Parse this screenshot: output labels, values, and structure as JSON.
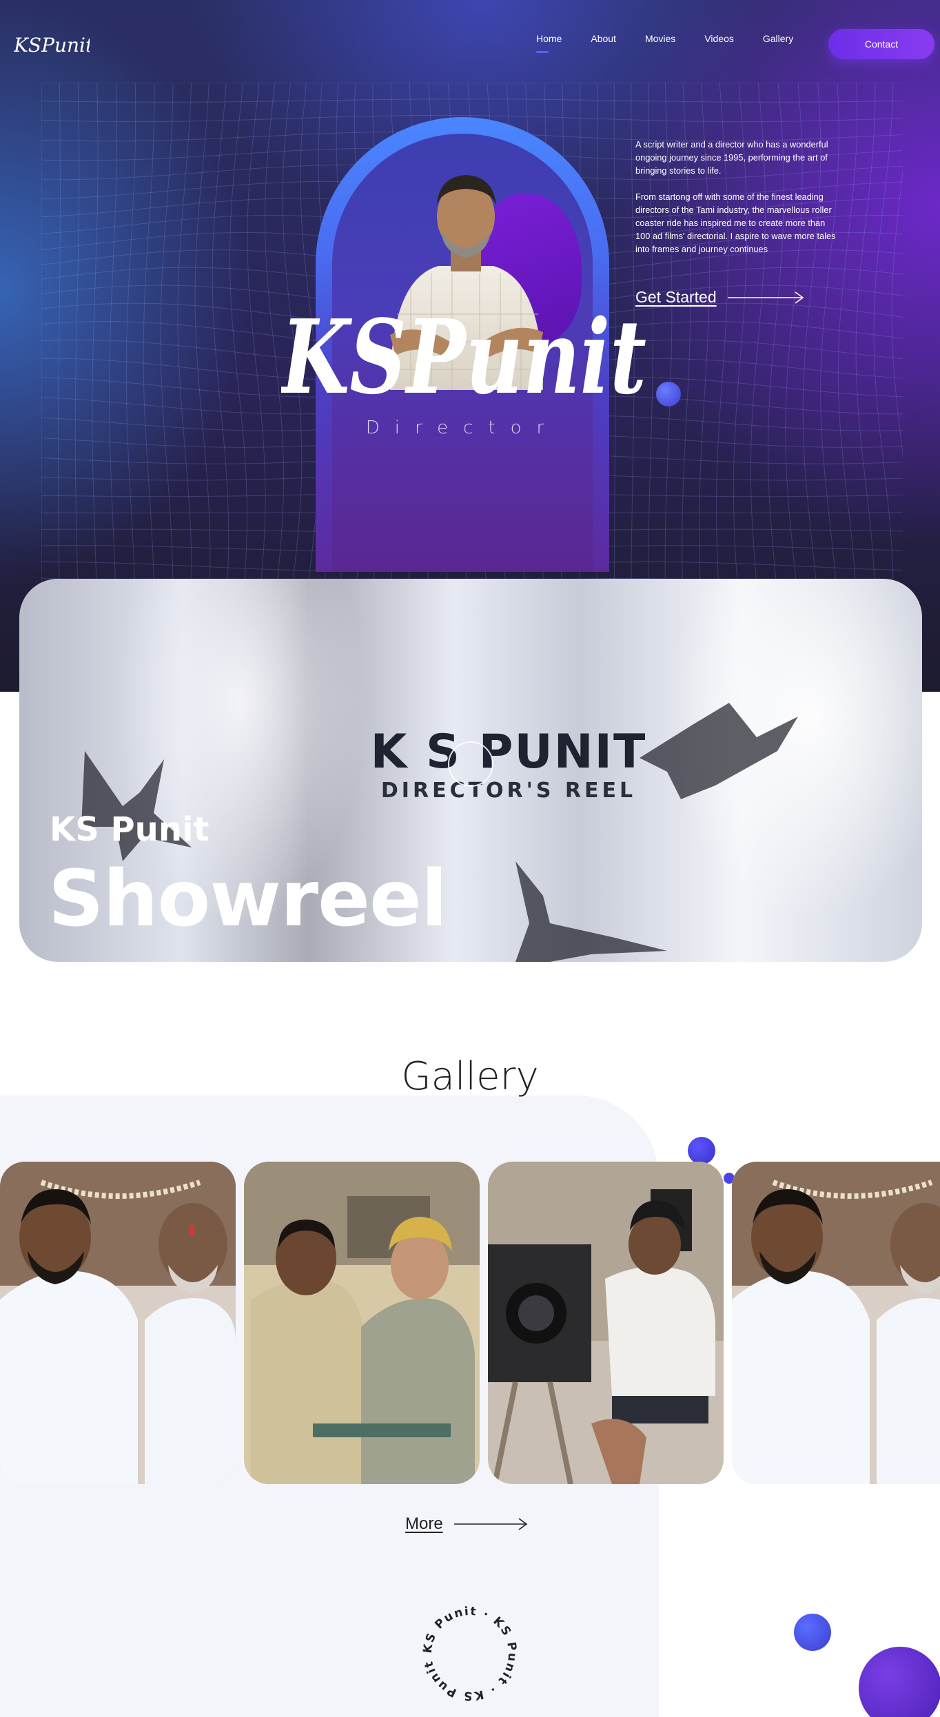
{
  "brand": {
    "logo_text": "KSPunit"
  },
  "nav": {
    "items": [
      {
        "label": "Home"
      },
      {
        "label": "About"
      },
      {
        "label": "Movies"
      },
      {
        "label": "Videos"
      },
      {
        "label": "Gallery"
      }
    ],
    "contact_label": "Contact"
  },
  "hero": {
    "name_logo": "KSPunit",
    "role": "Director",
    "paragraph1": "A script writer and a director who has a wonderful ongoing journey since 1995, performing the art of bringing stories to life.",
    "paragraph2": "From startong off with some of the finest leading directors of the Tami industry, the marvellous roller coaster ride has inspired me to create more than 100 ad films' directorial. I aspire to wave more tales into frames and journey continues",
    "cta_label": "Get Started"
  },
  "showreel": {
    "video_title": "K S PUNIT",
    "video_subtitle": "DIRECTOR'S REEL",
    "name": "KS Punit",
    "title": "Showreel"
  },
  "gallery": {
    "title": "Gallery",
    "more_label": "More"
  },
  "badge": {
    "ring_text": "KS Punit · KS Punit · KS Punit ·"
  },
  "colors": {
    "accent": "#6b2fe8",
    "arch_blue": "#4a86ff",
    "hero_dark": "#1d1b2e"
  }
}
